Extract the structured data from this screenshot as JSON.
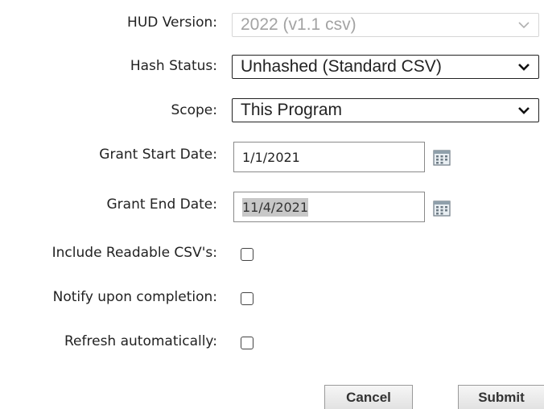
{
  "form": {
    "hud_version": {
      "label": "HUD Version:",
      "value": "2022 (v1.1 csv)"
    },
    "hash_status": {
      "label": "Hash Status:",
      "value": "Unhashed (Standard CSV)"
    },
    "scope": {
      "label": "Scope:",
      "value": "This Program"
    },
    "grant_start_date": {
      "label": "Grant Start Date:",
      "value": "1/1/2021"
    },
    "grant_end_date": {
      "label": "Grant End Date:",
      "value": "11/4/2021"
    },
    "include_readable_csvs": {
      "label": "Include Readable CSV's:",
      "checked": false
    },
    "notify_upon_completion": {
      "label": "Notify upon completion:",
      "checked": false
    },
    "refresh_automatically": {
      "label": "Refresh automatically:",
      "checked": false
    }
  },
  "buttons": {
    "cancel": "Cancel",
    "submit": "Submit"
  },
  "icons": {
    "select_arrow": "chevron-down-icon",
    "date_picker": "calendar-icon"
  }
}
